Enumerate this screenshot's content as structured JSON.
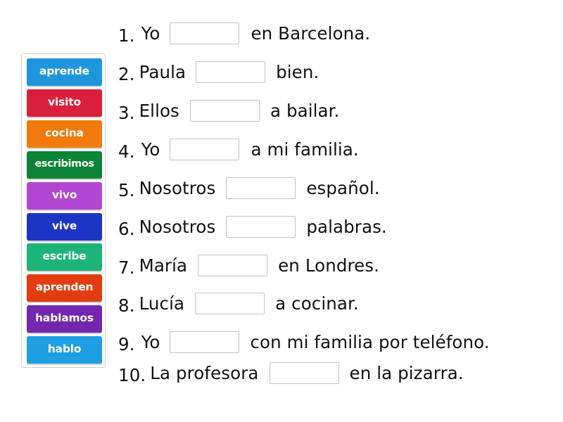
{
  "word_bank": {
    "tiles": [
      {
        "label": "aprende",
        "color": "#1e96de"
      },
      {
        "label": "visito",
        "color": "#da1f3d"
      },
      {
        "label": "cocina",
        "color": "#f27a0b"
      },
      {
        "label": "escribimos",
        "color": "#0c8436"
      },
      {
        "label": "vivo",
        "color": "#b445d3"
      },
      {
        "label": "vive",
        "color": "#1d35c4"
      },
      {
        "label": "escribe",
        "color": "#1cb478"
      },
      {
        "label": "aprenden",
        "color": "#e33c0f"
      },
      {
        "label": "hablamos",
        "color": "#7227ae"
      },
      {
        "label": "hablo",
        "color": "#1e9fe3"
      }
    ]
  },
  "sentences": [
    {
      "number": "1.",
      "before": "Yo",
      "after": "en Barcelona.",
      "answer": ""
    },
    {
      "number": "2.",
      "before": "Paula",
      "after": "bien.",
      "answer": ""
    },
    {
      "number": "3.",
      "before": "Ellos",
      "after": "a bailar.",
      "answer": ""
    },
    {
      "number": "4.",
      "before": "Yo",
      "after": "a mi familia.",
      "answer": ""
    },
    {
      "number": "5.",
      "before": "Nosotros",
      "after": "español.",
      "answer": ""
    },
    {
      "number": "6.",
      "before": "Nosotros",
      "after": "palabras.",
      "answer": ""
    },
    {
      "number": "7.",
      "before": "María",
      "after": "en Londres.",
      "answer": ""
    },
    {
      "number": "8.",
      "before": "Lucía",
      "after": "a cocinar.",
      "answer": ""
    },
    {
      "number": "9.",
      "before": "Yo",
      "after": "con mi familia por teléfono.",
      "answer": ""
    },
    {
      "number": "10.",
      "before": "La profesora",
      "after": "en la pizarra.",
      "answer": ""
    }
  ]
}
